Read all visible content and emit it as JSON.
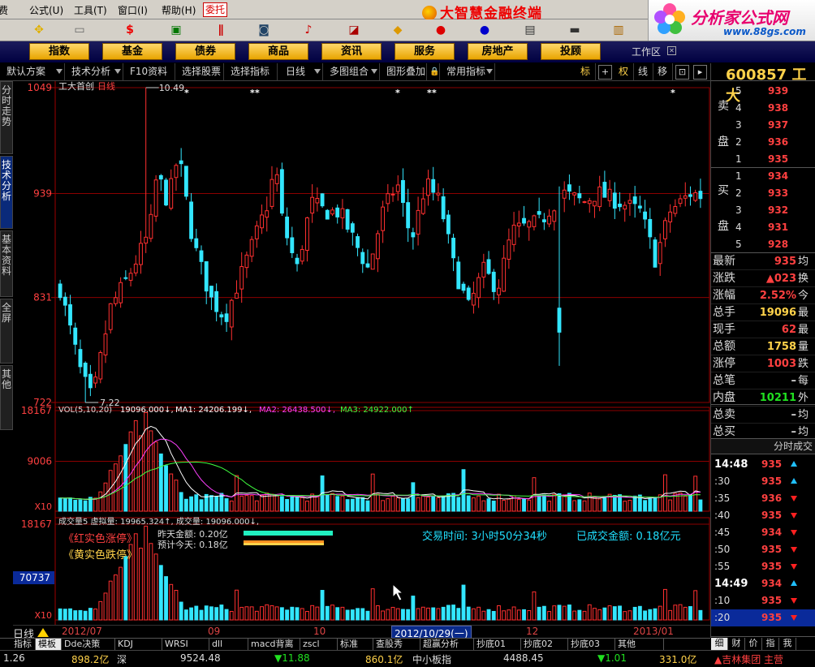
{
  "menu": {
    "items": [
      "费",
      "公式(U)",
      "工具(T)",
      "窗口(I)",
      "帮助(H)"
    ],
    "entrust": "委托",
    "app_title": "大智慧金融终端"
  },
  "logo": {
    "cn": "分析家公式网",
    "url": "www.88gs.com"
  },
  "nav": {
    "buttons": [
      "指数",
      "基金",
      "债券",
      "商品",
      "资讯",
      "服务",
      "房地产",
      "投顾"
    ],
    "workarea": "工作区"
  },
  "chart_toolbar": {
    "items": [
      "默认方案",
      "技术分析",
      "F10资料",
      "选择股票",
      "选择指标",
      "日线",
      "多图组合",
      "图形叠加",
      "常用指标"
    ],
    "icons": [
      "标",
      "+",
      "权",
      "线",
      "移"
    ]
  },
  "sidebar": {
    "tabs": [
      "分时走势",
      "技术分析",
      "基本资料",
      "全屏",
      "其他"
    ]
  },
  "main_chart": {
    "title": "工大首创",
    "period": "日线",
    "high_label": "10.49",
    "low_label": "7.22",
    "ytick_labels": [
      "1049",
      "939",
      "831",
      "722"
    ]
  },
  "vol_panel": {
    "legend": {
      "name": "VOL(5,10,20)",
      "vol": "19096.000↓,",
      "ma1": "MA1: 24206.199↓,",
      "ma2": "MA2: 26438.500↓,",
      "ma3": "MA3: 24922.000↑"
    },
    "ytick_labels": [
      "18167",
      "9006",
      "X10"
    ]
  },
  "amount_panel": {
    "legend": "成交量5  虚拟量: 19965.324↑, 成交量: 19096.000↓,",
    "red_text": "《红实色涨停》",
    "yellow_text": "《黄实色跌停》",
    "yesterday": "昨天金额: 0.20亿",
    "forecast": "预计今天: 0.18亿",
    "trade_time": "交易时间: 3小时50分34秒",
    "traded_amount": "已成交金额: 0.18亿元",
    "ytick_labels": [
      "18167",
      "70737",
      "X10"
    ],
    "bar_yesterday": 0.2,
    "bar_today": 0.18
  },
  "timeline": {
    "period": "日线",
    "labels": [
      "2012/07",
      "09",
      "10",
      "2012/10/29(一)",
      "12",
      "2013/01"
    ]
  },
  "bottom_tabs": [
    "指标",
    "模板",
    "Dde决策",
    "KDJ",
    "WRSI",
    "dll",
    "macd背离",
    "zscl",
    "标准",
    "查股秀",
    "超赢分析",
    "抄底01",
    "抄底02",
    "抄底03",
    "其他"
  ],
  "ticker": {
    "items": [
      "1.26",
      "898.2亿",
      "深",
      "9524.48",
      "▼11.88",
      "860.1亿",
      "中小板指",
      "4488.45",
      "▼1.01",
      "331.0亿",
      "▲吉林集团 主营"
    ]
  },
  "quote": {
    "code": "600857",
    "name": "工大",
    "asks": [
      {
        "level": "5",
        "price": "939"
      },
      {
        "level": "4",
        "price": "938"
      },
      {
        "level": "3",
        "price": "937"
      },
      {
        "level": "2",
        "price": "936"
      },
      {
        "level": "1",
        "price": "935"
      }
    ],
    "bids": [
      {
        "level": "1",
        "price": "934"
      },
      {
        "level": "2",
        "price": "933"
      },
      {
        "level": "3",
        "price": "932"
      },
      {
        "level": "4",
        "price": "931"
      },
      {
        "level": "5",
        "price": "928"
      }
    ],
    "ask_label": "卖盘",
    "bid_label": "买盘",
    "stats": [
      {
        "label": "最新",
        "value": "935",
        "x": "均"
      },
      {
        "label": "涨跌",
        "value": "▲023",
        "x": "换"
      },
      {
        "label": "涨幅",
        "value": "2.52%",
        "x": "今"
      },
      {
        "label": "总手",
        "value": "19096",
        "x": "最"
      },
      {
        "label": "现手",
        "value": "62",
        "x": "最"
      },
      {
        "label": "总额",
        "value": "1758",
        "x": "量"
      },
      {
        "label": "涨停",
        "value": "1003",
        "x": "跌"
      },
      {
        "label": "总笔",
        "value": "–",
        "x": "每"
      },
      {
        "label": "内盘",
        "value": "10211",
        "x": "外"
      },
      {
        "label": "总卖",
        "value": "–",
        "x": "均"
      },
      {
        "label": "总买",
        "value": "–",
        "x": "均"
      }
    ],
    "ticks_title": "分时成交",
    "ticks": [
      {
        "t": "14:48",
        "p": "935"
      },
      {
        "t": ":30",
        "p": "935"
      },
      {
        "t": ":35",
        "p": "936"
      },
      {
        "t": ":40",
        "p": "935"
      },
      {
        "t": ":45",
        "p": "934"
      },
      {
        "t": ":50",
        "p": "935"
      },
      {
        "t": ":55",
        "p": "935"
      },
      {
        "t": "14:49",
        "p": "934"
      },
      {
        "t": ":10",
        "p": "935"
      },
      {
        "t": ":20",
        "p": "935"
      }
    ],
    "tabs": [
      "细",
      "财",
      "价",
      "指",
      "我"
    ]
  },
  "chart_data": {
    "type": "candlestick",
    "ylim": [
      7.22,
      10.49
    ],
    "high": 10.49,
    "low": 7.22,
    "volume_ylim": [
      0,
      18167
    ],
    "ma_values": {
      "ma1": 24206.199,
      "ma2": 26438.5,
      "ma3": 24922.0
    },
    "current_volume": 19096.0,
    "virtual_volume": 19965.324
  },
  "colors": {
    "up": "#ff3030",
    "down": "#33e6ff",
    "grid": "#8b0000",
    "axis": "#a00000",
    "ma1": "#ffffff",
    "ma2": "#ff40ff",
    "ma3": "#40ff40",
    "yellow": "#ffd24a"
  }
}
